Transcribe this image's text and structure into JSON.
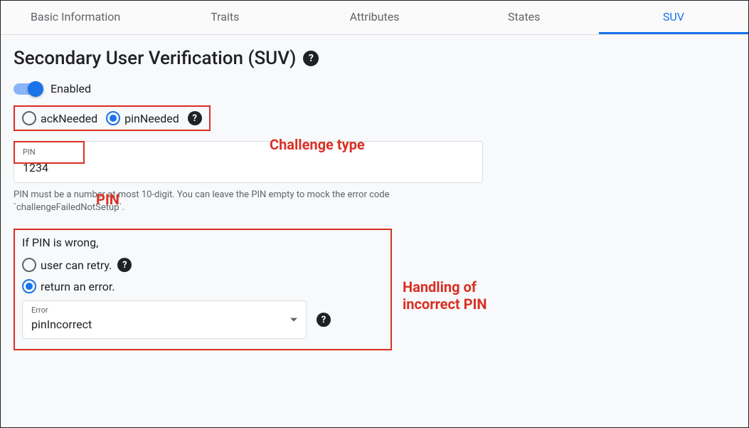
{
  "tabs": {
    "items": [
      "Basic Information",
      "Traits",
      "Attributes",
      "States",
      "SUV"
    ],
    "active_index": 4
  },
  "title": "Secondary User Verification (SUV)",
  "toggle": {
    "enabled": true,
    "label": "Enabled"
  },
  "challenge": {
    "options": [
      {
        "value": "ackNeeded",
        "checked": false
      },
      {
        "value": "pinNeeded",
        "checked": true
      }
    ]
  },
  "pin": {
    "field_label": "PIN",
    "value": "1234",
    "helper": "PIN must be a number at most 10-digit. You can leave the PIN empty to mock the error code `challengeFailedNotSetup`."
  },
  "wrong_pin": {
    "heading": "If PIN is wrong,",
    "options": [
      {
        "label": "user can retry.",
        "checked": false,
        "has_help": true
      },
      {
        "label": "return an error.",
        "checked": true,
        "has_help": false
      }
    ],
    "error_select": {
      "field_label": "Error",
      "value": "pinIncorrect"
    }
  },
  "annotations": {
    "challenge_type": "Challenge type",
    "pin": "PIN",
    "incorrect_pin": "Handling of\nincorrect PIN"
  }
}
